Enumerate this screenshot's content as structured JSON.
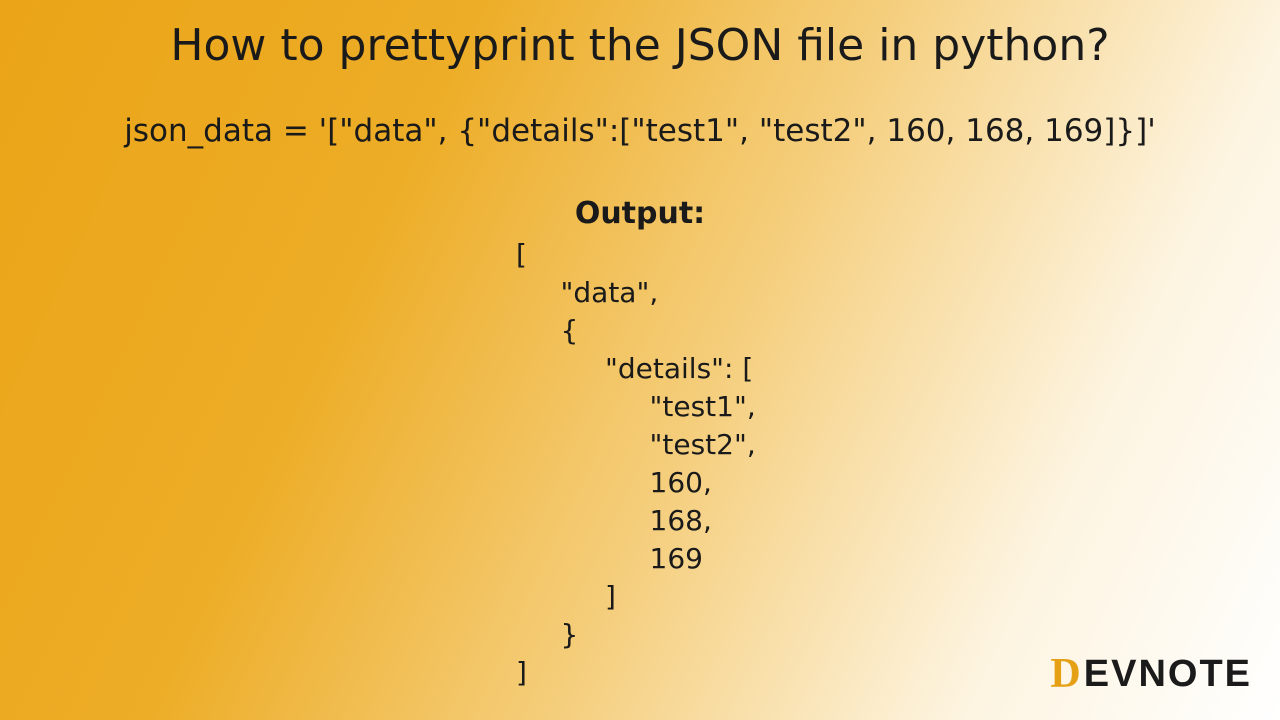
{
  "title": "How to prettyprint the JSON file in python?",
  "codeline": "json_data = '[\"data\", {\"details\":[\"test1\", \"test2\", 160, 168, 169]}]'",
  "output_label": "Output:",
  "output_text": "[\n     \"data\",\n     {\n          \"details\": [\n               \"test1\",\n               \"test2\",\n               160,\n               168,\n               169\n          ]\n     }\n]",
  "logo": {
    "first": "D",
    "rest": "EVNOTE"
  }
}
